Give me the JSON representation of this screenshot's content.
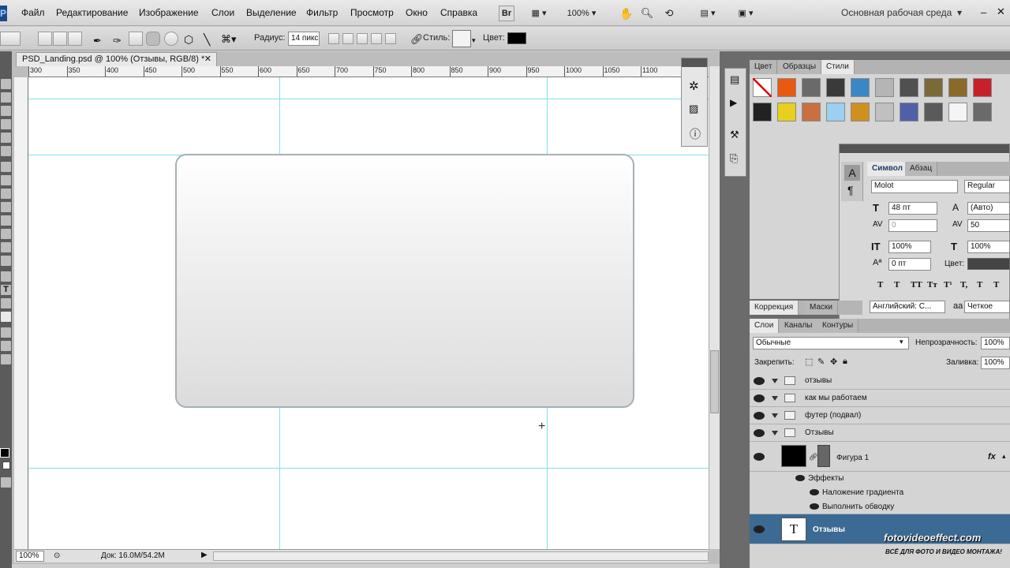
{
  "menubar": {
    "logo": "Ps",
    "items": [
      "Файл",
      "Редактирование",
      "Изображение",
      "Слои",
      "Выделение",
      "Фильтр",
      "Просмотр",
      "Окно",
      "Справка"
    ],
    "br_label": "Br",
    "zoom": "100%",
    "workspace": "Основная рабочая среда"
  },
  "options": {
    "radius_label": "Радиус:",
    "radius_value": "14 пикс",
    "style_label": "Стиль:",
    "color_label": "Цвет:",
    "fill_color": "#000000"
  },
  "document": {
    "tab_title": "PSD_Landing.psd @ 100% (Отзывы, RGB/8) *",
    "ruler_ticks": [
      "300",
      "350",
      "400",
      "450",
      "500",
      "550",
      "600",
      "650",
      "700",
      "750",
      "800",
      "850",
      "900",
      "950",
      "1000",
      "1050",
      "1100"
    ],
    "zoom_status": "100%",
    "doc_status": "Док: 16.0M/54.2M"
  },
  "styles_panel": {
    "tabs": [
      "Цвет",
      "Образцы",
      "Стили"
    ],
    "active_tab": "Стили",
    "swatch_colors": [
      "#ffffff",
      "#e85a10",
      "#6a6a6a",
      "#3a3a3a",
      "#3b86c6",
      "#b5b5b5",
      "#505050",
      "#7a6a3a",
      "#8a6a2a",
      "#c8202a",
      "#222222",
      "#e8d020",
      "#c87040",
      "#9ad0f0",
      "#d09020",
      "#c0c0c0",
      "#5060a8",
      "#5a5a5a",
      "#f4f4f4",
      "#6a6a6a"
    ]
  },
  "character_panel": {
    "tabs": [
      "Символ",
      "Абзац"
    ],
    "font_family": "Molot",
    "font_style": "Regular",
    "size": "48 пт",
    "leading": "(Авто)",
    "kerning": "0",
    "tracking": "50",
    "vscale": "100%",
    "hscale": "100%",
    "baseline": "0 пт",
    "color_label": "Цвет:",
    "text_color": "#444444",
    "language": "Английский: С...",
    "aa_label": "aa",
    "antialias": "Четкое",
    "style_buttons": [
      "T",
      "T",
      "TT",
      "Tт",
      "T¹",
      "T,",
      "T",
      "T"
    ]
  },
  "correction_tabs": [
    "Коррекция",
    "Маски"
  ],
  "layers_panel": {
    "tabs": [
      "Слои",
      "Каналы",
      "Контуры"
    ],
    "blend_mode": "Обычные",
    "opacity_label": "Непрозрачность:",
    "opacity": "100%",
    "lock_label": "Закрепить:",
    "fill_label": "Заливка:",
    "fill": "100%",
    "groups": [
      "отзывы",
      "как мы работаем",
      "футер (подвал)",
      "Отзывы"
    ],
    "shape_layer": "Фигура 1",
    "fx_label": "fx",
    "effects_label": "Эффекты",
    "effects": [
      "Наложение градиента",
      "Выполнить обводку"
    ],
    "text_layer": "Отзывы",
    "text_thumb": "T",
    "selected_color": "#3b6a94"
  },
  "watermark": {
    "site": "fotovideoeffect.com",
    "tagline": "ВСЁ ДЛЯ ФОТО И ВИДЕО МОНТАЖА!"
  }
}
